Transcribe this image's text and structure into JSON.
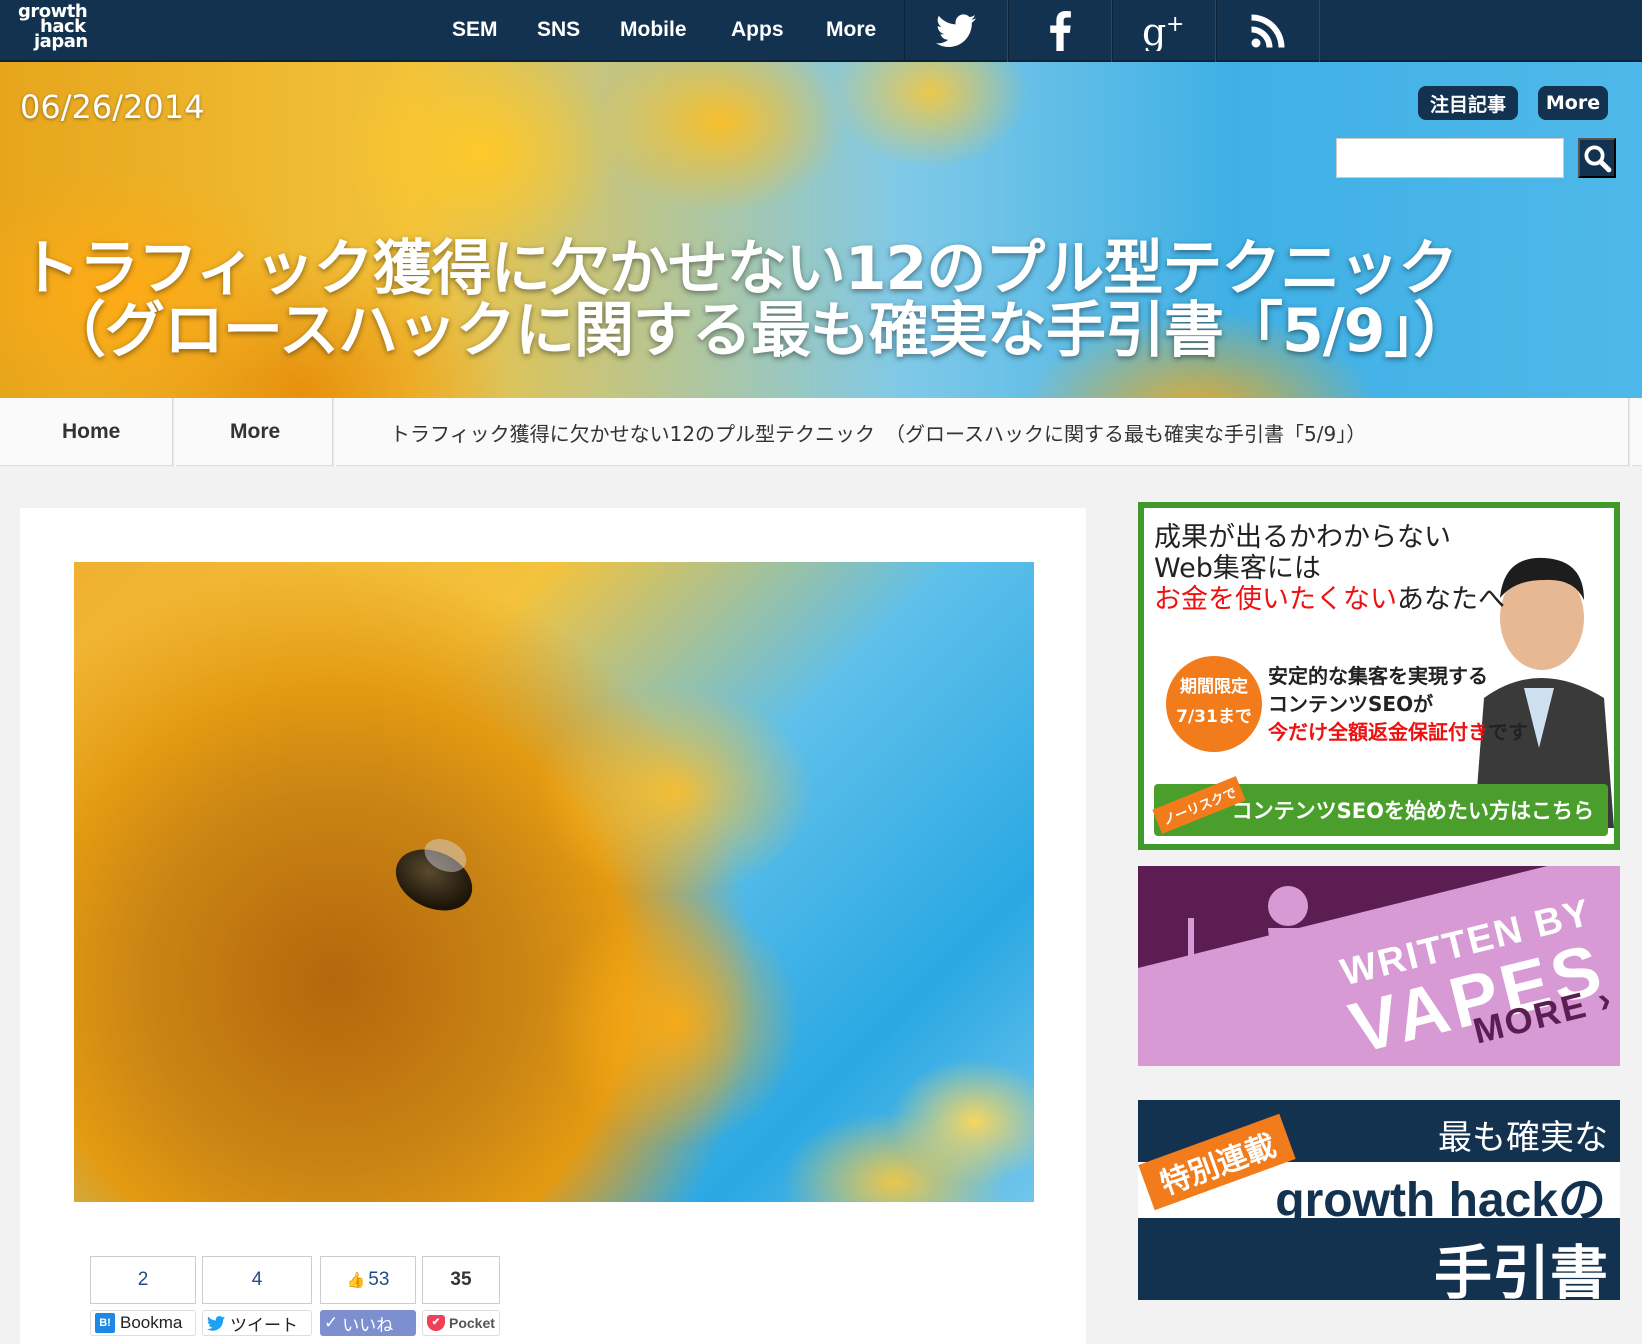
{
  "logo": {
    "line1": "growth",
    "line2": "hack",
    "line3": "japan"
  },
  "nav": {
    "items": [
      "SEM",
      "SNS",
      "Mobile",
      "Apps",
      "More"
    ]
  },
  "social": {
    "icons": [
      "twitter-icon",
      "facebook-icon",
      "google-plus-icon",
      "rss-icon"
    ]
  },
  "hero": {
    "date": "06/26/2014",
    "pill_featured": "注目記事",
    "pill_more": "More",
    "search_placeholder": "",
    "title_line1": "トラフィック獲得に欠かせない12のプル型テクニック",
    "title_line2": "（グロースハックに関する最も確実な手引書「5/9」）"
  },
  "breadcrumb": {
    "home": "Home",
    "more": "More",
    "current": "トラフィック獲得に欠かせない12のプル型テクニック　（グロースハックに関する最も確実な手引書「5/9」）"
  },
  "share": {
    "hatena_count": "2",
    "hatena_label": "Bookma",
    "tweet_count": "4",
    "tweet_label": "ツイート",
    "like_count": "53",
    "like_label": "いいね",
    "pocket_count": "35",
    "pocket_label": "Pocket"
  },
  "ad1": {
    "headline1": "成果が出るかわからない",
    "headline2": "Web集客には",
    "headline3_red": "お金を使いたくない",
    "headline3_rest": "あなたへ",
    "badge_line1": "期間限定",
    "badge_line2": "7/31まで",
    "sub1": "安定的な集客を実現する",
    "sub2": "コンテンツSEOが",
    "sub3_red": "今だけ全額返金保証付き",
    "sub3_rest": "です",
    "ribbon": "ノーリスクで",
    "cta": "コンテンツSEOを始めたい方はこちら"
  },
  "ad2": {
    "line1": "WRITTEN BY",
    "line2": "VAPES",
    "line3": "MORE ›"
  },
  "ad3": {
    "tag": "特別連載",
    "line1": "最も確実な",
    "line2": "growth hackの",
    "line3": "手引書"
  },
  "colors": {
    "navy": "#13324f",
    "green": "#3f9a2b",
    "orange": "#f27b1c",
    "purple": "#5b1d52",
    "pink": "#d79ad4"
  }
}
